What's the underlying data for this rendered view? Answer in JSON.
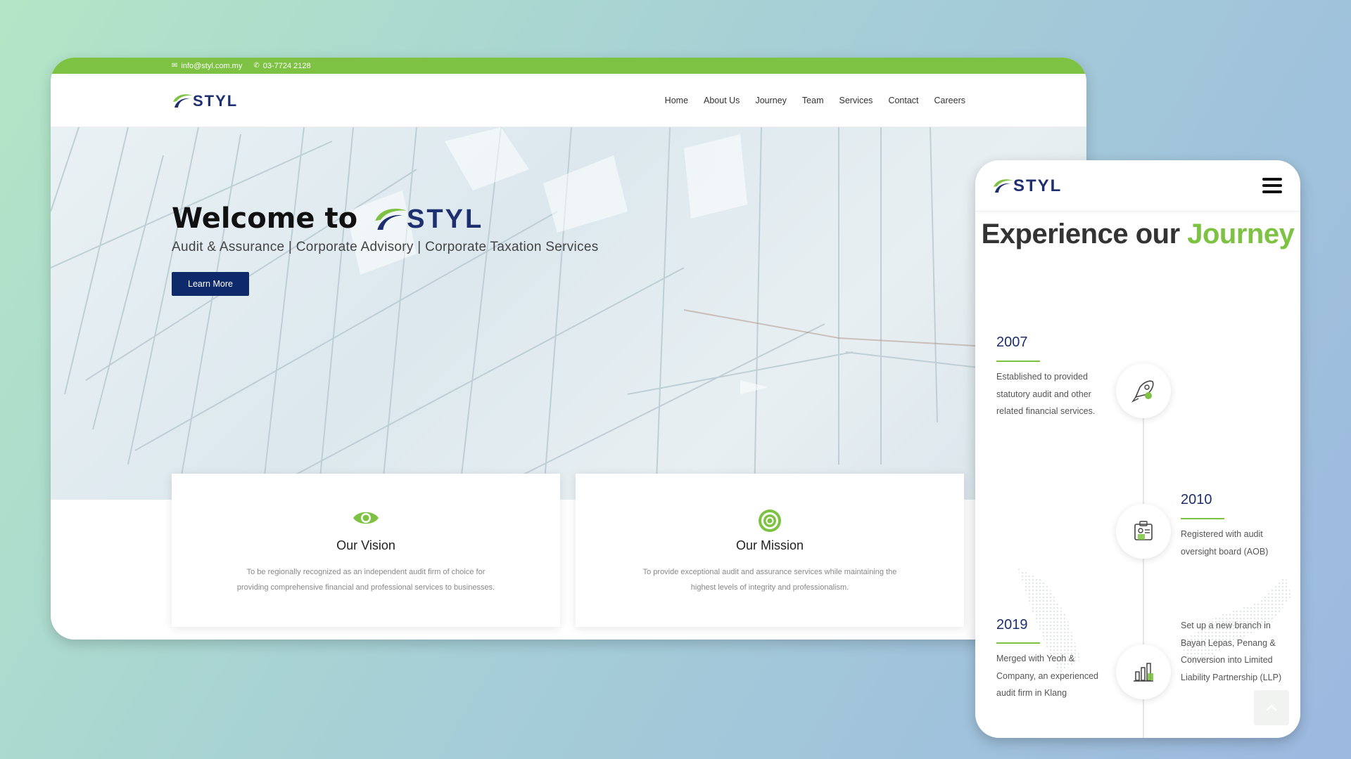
{
  "desktop": {
    "topbar": {
      "email_icon": "envelope-icon",
      "email": "info@styl.com.my",
      "phone_icon": "phone-icon",
      "phone": "03-7724 2128"
    },
    "logo_text": "STYL",
    "nav": [
      "Home",
      "About Us",
      "Journey",
      "Team",
      "Services",
      "Contact",
      "Careers"
    ],
    "hero": {
      "welcome": "Welcome to",
      "logo_text": "STYL",
      "subtitle": "Audit & Assurance | Corporate Advisory | Corporate Taxation Services",
      "button": "Learn More"
    },
    "cards": [
      {
        "icon": "eye-icon",
        "title": "Our Vision",
        "text": "To be regionally recognized as an independent audit firm of choice for providing comprehensive financial and professional services to businesses."
      },
      {
        "icon": "target-icon",
        "title": "Our Mission",
        "text": "To provide exceptional audit and assurance services while maintaining the highest levels of integrity and professionalism."
      }
    ]
  },
  "mobile": {
    "logo_text": "STYL",
    "menu_icon": "hamburger-menu-icon",
    "title_prefix": "Experience our ",
    "title_accent": "Journey",
    "timeline": [
      {
        "year": "2007",
        "text": "Established to provided statutory audit and other related financial services.",
        "icon": "rocket-icon"
      },
      {
        "year": "2010",
        "text": "Registered with audit oversight board (AOB)",
        "icon": "id-card-icon"
      },
      {
        "year": "2019",
        "text": "Merged with Yeoh & Company, an experienced audit firm in Klang",
        "icon": "bar-chart-icon"
      },
      {
        "year": "",
        "text": "Set up a new branch in Bayan Lepas, Penang & Conversion into Limited Liability Partnership (LLP)",
        "icon": ""
      }
    ],
    "scroll_top_icon": "chevron-up-icon"
  },
  "colors": {
    "brand_green": "#7dc242",
    "brand_navy": "#1d2f6f",
    "button_navy": "#0e2a6b"
  }
}
